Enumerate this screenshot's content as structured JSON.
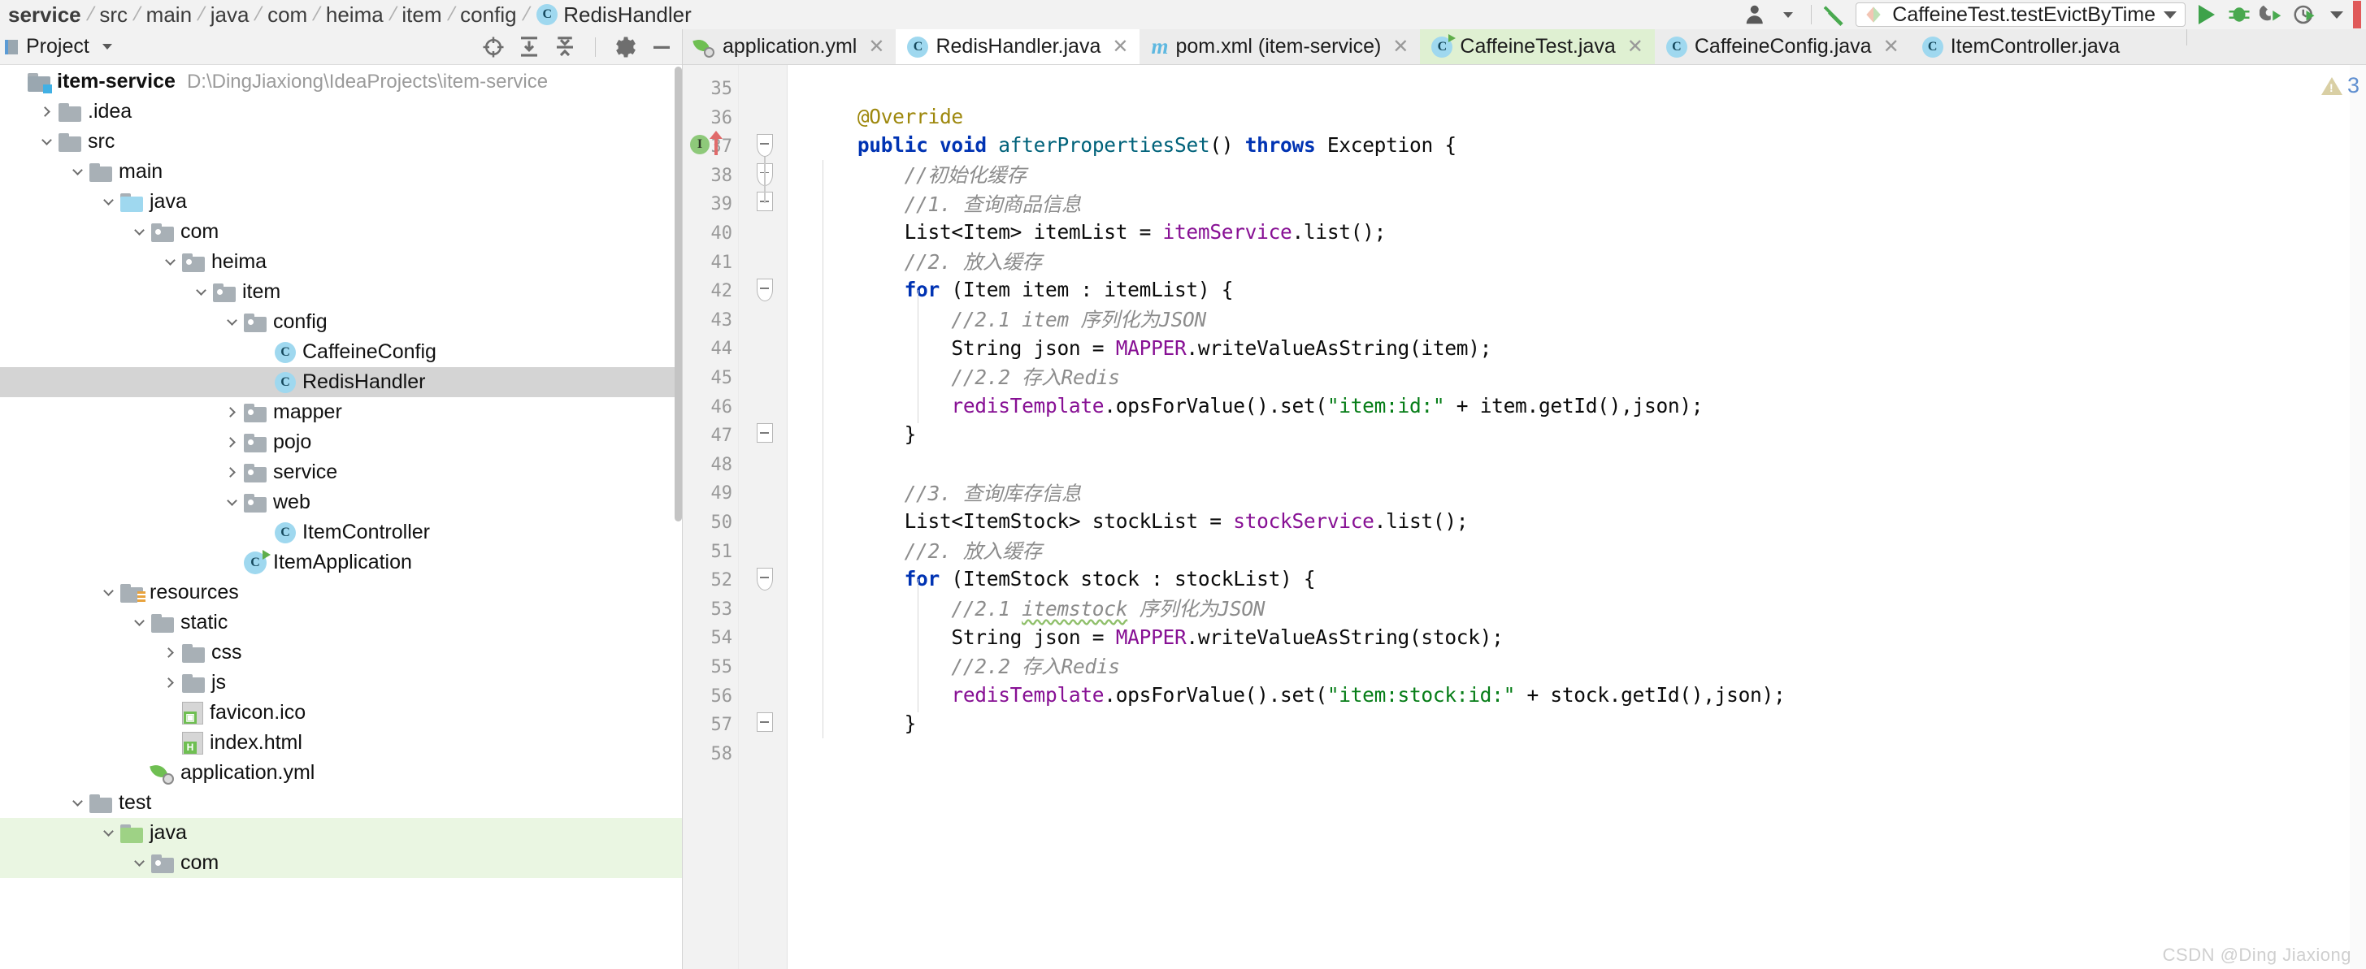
{
  "breadcrumb": {
    "items": [
      "service",
      "src",
      "main",
      "java",
      "com",
      "heima",
      "item",
      "config"
    ],
    "class_name": "RedisHandler",
    "class_icon": "java-class-icon"
  },
  "toolbar": {
    "user_icon": "user-avatar-icon",
    "user_caret": "chevron-down-icon",
    "build_icon": "hammer-build-icon",
    "run_config_label": "CaffeineTest.testEvictByTime",
    "run_config_icon": "run-configuration-icon",
    "run_config_caret": "chevron-down-icon",
    "run_icon": "run-play-icon",
    "debug_icon": "debug-bug-icon",
    "run_coverage_icon": "run-with-coverage-icon",
    "profiler_icon": "profiler-icon",
    "more_caret": "chevron-down-icon"
  },
  "project_panel": {
    "title": "Project",
    "title_caret": "chevron-down-icon",
    "actions": [
      {
        "name": "locate-file-icon"
      },
      {
        "name": "expand-all-icon"
      },
      {
        "name": "collapse-all-icon"
      },
      {
        "name": "settings-gear-icon"
      },
      {
        "name": "hide-panel-icon"
      }
    ],
    "tree": [
      {
        "label": "item-service",
        "hint": "D:\\DingJiaxiong\\IdeaProjects\\item-service",
        "indent": 0,
        "arrow": "none",
        "icon": "module-folder-icon",
        "bold": true,
        "state": "normal"
      },
      {
        "label": ".idea",
        "hint": "",
        "indent": 1,
        "arrow": "right",
        "icon": "folder-icon",
        "bold": false,
        "state": "normal"
      },
      {
        "label": "src",
        "hint": "",
        "indent": 1,
        "arrow": "down",
        "icon": "folder-icon",
        "bold": false,
        "state": "normal"
      },
      {
        "label": "main",
        "hint": "",
        "indent": 2,
        "arrow": "down",
        "icon": "folder-icon",
        "bold": false,
        "state": "normal"
      },
      {
        "label": "java",
        "hint": "",
        "indent": 3,
        "arrow": "down",
        "icon": "source-folder-icon",
        "bold": false,
        "state": "normal"
      },
      {
        "label": "com",
        "hint": "",
        "indent": 4,
        "arrow": "down",
        "icon": "package-folder-icon",
        "bold": false,
        "state": "normal"
      },
      {
        "label": "heima",
        "hint": "",
        "indent": 5,
        "arrow": "down",
        "icon": "package-folder-icon",
        "bold": false,
        "state": "normal"
      },
      {
        "label": "item",
        "hint": "",
        "indent": 6,
        "arrow": "down",
        "icon": "package-folder-icon",
        "bold": false,
        "state": "normal"
      },
      {
        "label": "config",
        "hint": "",
        "indent": 7,
        "arrow": "down",
        "icon": "package-folder-icon",
        "bold": false,
        "state": "normal"
      },
      {
        "label": "CaffeineConfig",
        "hint": "",
        "indent": 8,
        "arrow": "none",
        "icon": "java-class-icon",
        "bold": false,
        "state": "normal"
      },
      {
        "label": "RedisHandler",
        "hint": "",
        "indent": 8,
        "arrow": "none",
        "icon": "java-class-icon",
        "bold": false,
        "state": "selected"
      },
      {
        "label": "mapper",
        "hint": "",
        "indent": 7,
        "arrow": "right",
        "icon": "package-folder-icon",
        "bold": false,
        "state": "normal"
      },
      {
        "label": "pojo",
        "hint": "",
        "indent": 7,
        "arrow": "right",
        "icon": "package-folder-icon",
        "bold": false,
        "state": "normal"
      },
      {
        "label": "service",
        "hint": "",
        "indent": 7,
        "arrow": "right",
        "icon": "package-folder-icon",
        "bold": false,
        "state": "normal"
      },
      {
        "label": "web",
        "hint": "",
        "indent": 7,
        "arrow": "down",
        "icon": "package-folder-icon",
        "bold": false,
        "state": "normal"
      },
      {
        "label": "ItemController",
        "hint": "",
        "indent": 8,
        "arrow": "none",
        "icon": "java-class-icon",
        "bold": false,
        "state": "normal"
      },
      {
        "label": "ItemApplication",
        "hint": "",
        "indent": 7,
        "arrow": "none",
        "icon": "runnable-class-icon",
        "bold": false,
        "state": "normal"
      },
      {
        "label": "resources",
        "hint": "",
        "indent": 3,
        "arrow": "down",
        "icon": "resources-folder-icon",
        "bold": false,
        "state": "normal"
      },
      {
        "label": "static",
        "hint": "",
        "indent": 4,
        "arrow": "down",
        "icon": "folder-icon",
        "bold": false,
        "state": "normal"
      },
      {
        "label": "css",
        "hint": "",
        "indent": 5,
        "arrow": "right",
        "icon": "folder-icon",
        "bold": false,
        "state": "normal"
      },
      {
        "label": "js",
        "hint": "",
        "indent": 5,
        "arrow": "right",
        "icon": "folder-icon",
        "bold": false,
        "state": "normal"
      },
      {
        "label": "favicon.ico",
        "hint": "",
        "indent": 5,
        "arrow": "none",
        "icon": "image-file-icon",
        "bold": false,
        "state": "normal"
      },
      {
        "label": "index.html",
        "hint": "",
        "indent": 5,
        "arrow": "none",
        "icon": "html-file-icon",
        "bold": false,
        "state": "normal"
      },
      {
        "label": "application.yml",
        "hint": "",
        "indent": 4,
        "arrow": "none",
        "icon": "spring-yml-icon",
        "bold": false,
        "state": "normal"
      },
      {
        "label": "test",
        "hint": "",
        "indent": 2,
        "arrow": "down",
        "icon": "folder-icon",
        "bold": false,
        "state": "normal"
      },
      {
        "label": "java",
        "hint": "",
        "indent": 3,
        "arrow": "down",
        "icon": "test-source-folder-icon",
        "bold": false,
        "state": "greenbg"
      },
      {
        "label": "com",
        "hint": "",
        "indent": 4,
        "arrow": "down",
        "icon": "package-folder-icon",
        "bold": false,
        "state": "greenbg"
      }
    ]
  },
  "tabs": [
    {
      "label": "application.yml",
      "icon": "spring-yml-icon",
      "state": "normal",
      "closable": true
    },
    {
      "label": "RedisHandler.java",
      "icon": "java-class-icon",
      "state": "active",
      "closable": true
    },
    {
      "label": "pom.xml (item-service)",
      "icon": "maven-icon",
      "state": "normal",
      "closable": true
    },
    {
      "label": "CaffeineTest.java",
      "icon": "java-test-class-icon",
      "state": "test-active",
      "closable": true
    },
    {
      "label": "CaffeineConfig.java",
      "icon": "java-class-icon",
      "state": "normal",
      "closable": true
    },
    {
      "label": "ItemController.java",
      "icon": "java-class-icon",
      "state": "normal",
      "closable": false
    }
  ],
  "editor": {
    "file": "RedisHandler.java",
    "warning_count": "3",
    "warning_icon": "warning-triangle-icon",
    "first_line_number": 35,
    "lines": [
      {
        "n": 35,
        "segs": []
      },
      {
        "n": 36,
        "segs": [
          {
            "t": "    ",
            "c": ""
          },
          {
            "t": "@Override",
            "c": "an"
          }
        ]
      },
      {
        "n": 37,
        "segs": [
          {
            "t": "    ",
            "c": ""
          },
          {
            "t": "public",
            "c": "k"
          },
          {
            "t": " ",
            "c": ""
          },
          {
            "t": "void",
            "c": "k"
          },
          {
            "t": " ",
            "c": ""
          },
          {
            "t": "afterPropertiesSet",
            "c": "fn"
          },
          {
            "t": "() ",
            "c": ""
          },
          {
            "t": "throws",
            "c": "k"
          },
          {
            "t": " Exception {",
            "c": ""
          }
        ],
        "gutter": "implements-marker",
        "fold": "open-pointed"
      },
      {
        "n": 38,
        "segs": [
          {
            "t": "        ",
            "c": ""
          },
          {
            "t": "//初始化缓存",
            "c": "cm"
          }
        ],
        "fold": "open-pointed"
      },
      {
        "n": 39,
        "segs": [
          {
            "t": "        ",
            "c": ""
          },
          {
            "t": "//1. 查询商品信息",
            "c": "cm"
          }
        ],
        "fold": "open-square"
      },
      {
        "n": 40,
        "segs": [
          {
            "t": "        List<Item> itemList = ",
            "c": ""
          },
          {
            "t": "itemService",
            "c": "fld"
          },
          {
            "t": ".list();",
            "c": ""
          }
        ]
      },
      {
        "n": 41,
        "segs": [
          {
            "t": "        ",
            "c": ""
          },
          {
            "t": "//2. 放入缓存",
            "c": "cm"
          }
        ]
      },
      {
        "n": 42,
        "segs": [
          {
            "t": "        ",
            "c": ""
          },
          {
            "t": "for",
            "c": "k"
          },
          {
            "t": " (Item item : itemList) {",
            "c": ""
          }
        ],
        "fold": "open-pointed"
      },
      {
        "n": 43,
        "segs": [
          {
            "t": "            ",
            "c": ""
          },
          {
            "t": "//2.1 item 序列化为JSON",
            "c": "cm"
          }
        ]
      },
      {
        "n": 44,
        "segs": [
          {
            "t": "            String json = ",
            "c": ""
          },
          {
            "t": "MAPPER",
            "c": "fld"
          },
          {
            "t": ".writeValueAsString(item);",
            "c": ""
          }
        ]
      },
      {
        "n": 45,
        "segs": [
          {
            "t": "            ",
            "c": ""
          },
          {
            "t": "//2.2 存入Redis",
            "c": "cm"
          }
        ]
      },
      {
        "n": 46,
        "segs": [
          {
            "t": "            ",
            "c": ""
          },
          {
            "t": "redisTemplate",
            "c": "fld"
          },
          {
            "t": ".opsForValue().set(",
            "c": ""
          },
          {
            "t": "\"item:id:\"",
            "c": "st"
          },
          {
            "t": " + item.getId(),json);",
            "c": ""
          }
        ]
      },
      {
        "n": 47,
        "segs": [
          {
            "t": "        }",
            "c": ""
          }
        ],
        "fold": "close-square"
      },
      {
        "n": 48,
        "segs": []
      },
      {
        "n": 49,
        "segs": [
          {
            "t": "        ",
            "c": ""
          },
          {
            "t": "//3. 查询库存信息",
            "c": "cm"
          }
        ]
      },
      {
        "n": 50,
        "segs": [
          {
            "t": "        List<ItemStock> stockList = ",
            "c": ""
          },
          {
            "t": "stockService",
            "c": "fld"
          },
          {
            "t": ".list();",
            "c": ""
          }
        ]
      },
      {
        "n": 51,
        "segs": [
          {
            "t": "        ",
            "c": ""
          },
          {
            "t": "//2. 放入缓存",
            "c": "cm"
          }
        ]
      },
      {
        "n": 52,
        "segs": [
          {
            "t": "        ",
            "c": ""
          },
          {
            "t": "for",
            "c": "k"
          },
          {
            "t": " (ItemStock stock : stockList) {",
            "c": ""
          }
        ],
        "fold": "open-pointed"
      },
      {
        "n": 53,
        "segs": [
          {
            "t": "            ",
            "c": ""
          },
          {
            "t": "//2.1 ",
            "c": "cm"
          },
          {
            "t": "itemstock",
            "c": "cm squiggle"
          },
          {
            "t": " 序列化为JSON",
            "c": "cm"
          }
        ]
      },
      {
        "n": 54,
        "segs": [
          {
            "t": "            String json = ",
            "c": ""
          },
          {
            "t": "MAPPER",
            "c": "fld"
          },
          {
            "t": ".writeValueAsString(stock);",
            "c": ""
          }
        ]
      },
      {
        "n": 55,
        "segs": [
          {
            "t": "            ",
            "c": ""
          },
          {
            "t": "//2.2 存入Redis",
            "c": "cm"
          }
        ]
      },
      {
        "n": 56,
        "segs": [
          {
            "t": "            ",
            "c": ""
          },
          {
            "t": "redisTemplate",
            "c": "fld"
          },
          {
            "t": ".opsForValue().set(",
            "c": ""
          },
          {
            "t": "\"item:stock:id:\"",
            "c": "st"
          },
          {
            "t": " + stock.getId(),json);",
            "c": ""
          }
        ]
      },
      {
        "n": 57,
        "segs": [
          {
            "t": "        }",
            "c": ""
          }
        ],
        "fold": "close-square"
      },
      {
        "n": 58,
        "segs": []
      }
    ]
  },
  "watermark": "CSDN @Ding Jiaxiong"
}
